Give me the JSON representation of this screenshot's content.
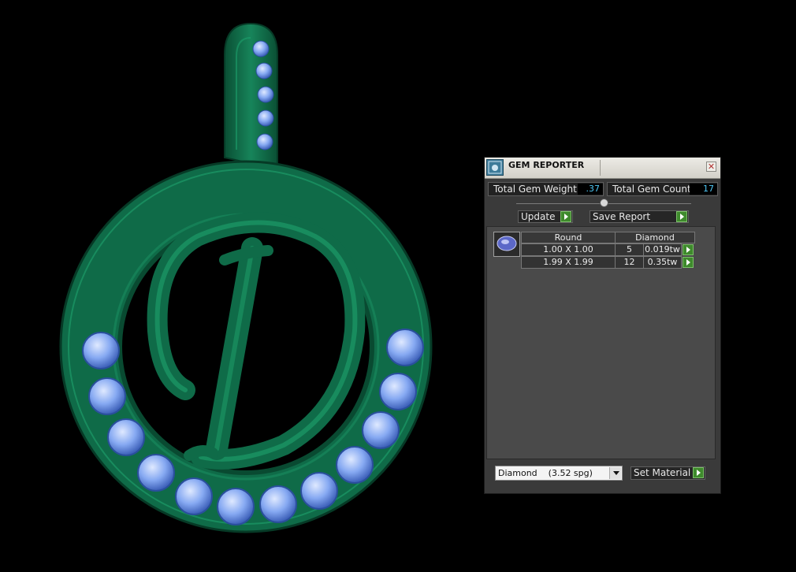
{
  "panel": {
    "title": "GEM REPORTER",
    "close_icon": "close-icon",
    "total_gem_weight_label": "Total Gem Weight",
    "total_gem_weight": ".37",
    "total_gem_count_label": "Total Gem Count",
    "total_gem_count": "17",
    "update_label": "Update",
    "save_report_label": "Save Report",
    "table": {
      "headers": [
        "Round",
        "Diamond"
      ],
      "rows": [
        {
          "size": "1.00 X 1.00",
          "count": "5",
          "weight": "0.019tw"
        },
        {
          "size": "1.99 X 1.99",
          "count": "12",
          "weight": "0.35tw"
        }
      ]
    },
    "material_select": "Diamond    (3.52 spg)",
    "set_material_label": "Set Material"
  },
  "colors": {
    "metal": "#0f6b48",
    "gem": "#7fa8f0",
    "accent_green": "#3e8a2c",
    "value_blue": "#4fc7f4"
  }
}
